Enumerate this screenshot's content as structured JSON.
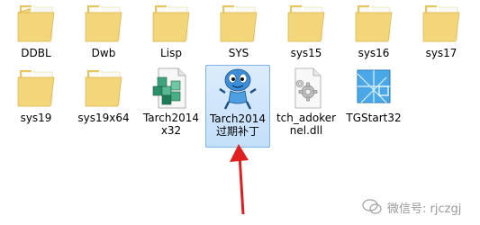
{
  "items": [
    {
      "label": "DDBL",
      "type": "folder"
    },
    {
      "label": "Dwb",
      "type": "folder"
    },
    {
      "label": "Lisp",
      "type": "folder"
    },
    {
      "label": "SYS",
      "type": "folder"
    },
    {
      "label": "sys15",
      "type": "folder"
    },
    {
      "label": "sys16",
      "type": "folder"
    },
    {
      "label": "sys17",
      "type": "folder"
    },
    {
      "label": "sys19",
      "type": "folder"
    },
    {
      "label": "sys19x64",
      "type": "folder"
    },
    {
      "label": "Tarch2014x32",
      "type": "registry-file"
    },
    {
      "label": "Tarch2014过期补丁",
      "type": "application"
    },
    {
      "label": "tch_adokernel.dll",
      "type": "dll-file"
    },
    {
      "label": "TGStart32",
      "type": "app-icon"
    }
  ],
  "selected_label": "Tarch2014过期补丁",
  "watermark": {
    "text": "微信号: rjczgj"
  },
  "colors": {
    "arrow": "#e02020",
    "selection": "#cce4fc",
    "folder": "#f3d679"
  }
}
